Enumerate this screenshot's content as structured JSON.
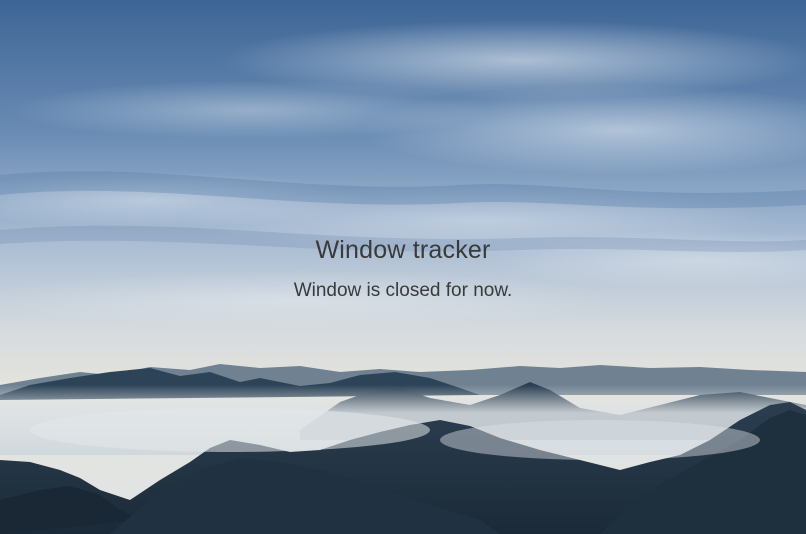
{
  "page": {
    "title": "Window tracker",
    "status_message": "Window is closed for now."
  },
  "background": {
    "description_icon": "mountain-landscape-image",
    "sky_top_color": "#3f6797",
    "sky_mid_color": "#b9c9dc",
    "horizon_color": "#e3e4e1",
    "mountain_dark_color": "#1f3140",
    "mist_color": "#d9dfe3"
  }
}
